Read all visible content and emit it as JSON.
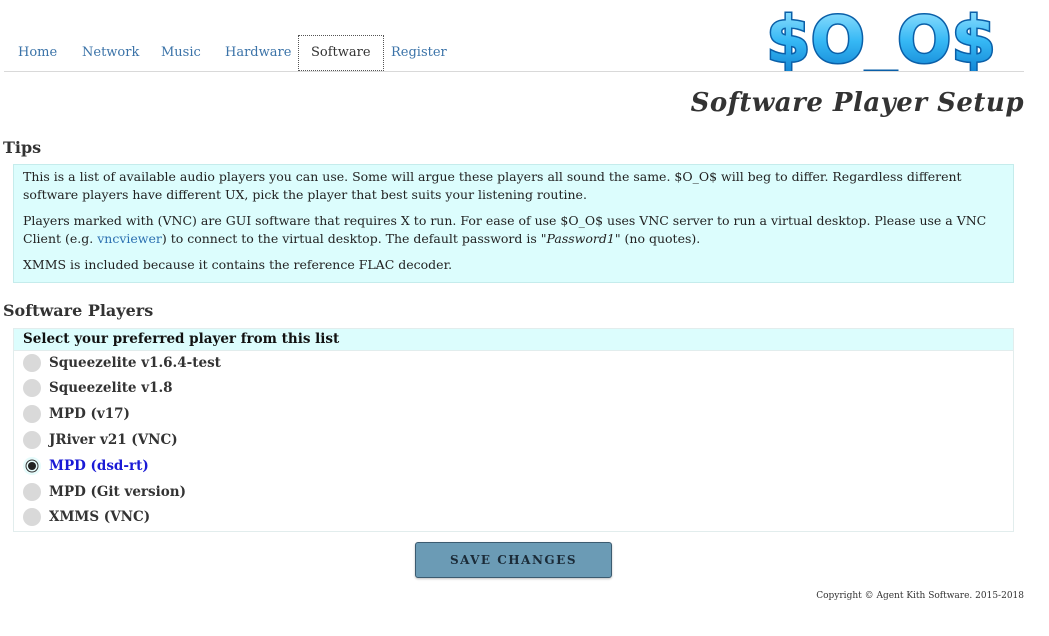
{
  "logo": {
    "text": "$O_O$"
  },
  "nav": {
    "tabs": [
      {
        "label": "Home"
      },
      {
        "label": "Network"
      },
      {
        "label": "Music"
      },
      {
        "label": "Hardware"
      },
      {
        "label": "Software",
        "active": true
      },
      {
        "label": "Register"
      }
    ]
  },
  "page_title": "Software Player Setup",
  "tips": {
    "heading": "Tips",
    "p1": "This is a list of available audio players you can use. Some will argue these players all sound the same. $O_O$ will beg to differ. Regardless different software players have different UX, pick the player that best suits your listening routine.",
    "p2_before": "Players marked with (VNC) are GUI software that requires X to run. For ease of use $O_O$ uses VNC server to run a virtual desktop. Please use a VNC Client (e.g. ",
    "p2_link": "vncviewer",
    "p2_middle": ") to connect to the virtual desktop. The default password is \"",
    "p2_password": "Password1",
    "p2_after": "\" (no quotes).",
    "p3": "XMMS is included because it contains the reference FLAC decoder."
  },
  "players": {
    "heading": "Software Players",
    "list_header": "Select your preferred player from this list",
    "options": [
      {
        "label": "Squeezelite v1.6.4-test",
        "selected": false
      },
      {
        "label": "Squeezelite v1.8",
        "selected": false
      },
      {
        "label": "MPD (v17)",
        "selected": false
      },
      {
        "label": "JRiver v21 (VNC)",
        "selected": false
      },
      {
        "label": "MPD (dsd-rt)",
        "selected": true
      },
      {
        "label": "MPD (Git version)",
        "selected": false
      },
      {
        "label": "XMMS (VNC)",
        "selected": false
      }
    ]
  },
  "save_button": {
    "label": "SAVE CHANGES"
  },
  "footer": {
    "copyright": "Copyright © Agent Kith Software. 2015-2018"
  },
  "colors": {
    "link": "#3b73a8",
    "tips_bg": "#dcfdfd",
    "button_bg": "#6b9bb5",
    "selected_text": "#1a1ad6"
  }
}
